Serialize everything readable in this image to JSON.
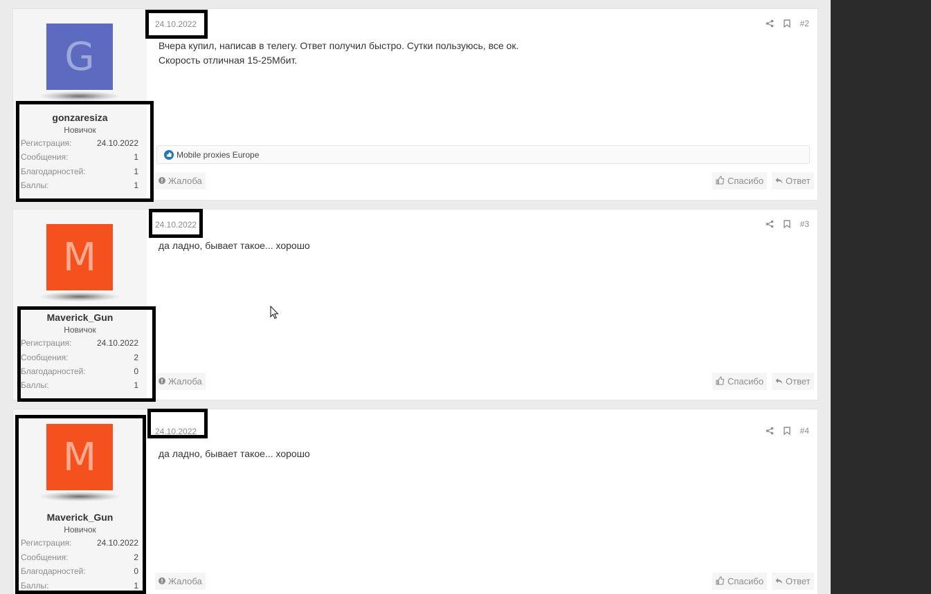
{
  "posts": [
    {
      "date": "24.10.2022",
      "number": "#2",
      "avatar_letter": "G",
      "avatar_bg": "#5c6bc0",
      "avatar_fg": "#9fa8da",
      "username": "gonzaresiza",
      "user_title": "Новичок",
      "stats": [
        {
          "label": "Регистрация:",
          "value": "24.10.2022"
        },
        {
          "label": "Сообщения:",
          "value": "1"
        },
        {
          "label": "Благодарностей:",
          "value": "1"
        },
        {
          "label": "Баллы:",
          "value": "1"
        }
      ],
      "body_lines": [
        "Вчера купил, написав в телегу. Ответ получил быстро. Сутки пользуюсь, все ок.",
        "Скорость отличная 15-25Мбит."
      ],
      "reaction_users": "Mobile proxies Europe",
      "report_label": "Жалоба",
      "like_label": "Спасибо",
      "reply_label": "Ответ"
    },
    {
      "date": "24.10.2022",
      "number": "#3",
      "avatar_letter": "M",
      "avatar_bg": "#f4511e",
      "avatar_fg": "#ffab91",
      "username": "Maverick_Gun",
      "user_title": "Новичок",
      "stats": [
        {
          "label": "Регистрация:",
          "value": "24.10.2022"
        },
        {
          "label": "Сообщения:",
          "value": "2"
        },
        {
          "label": "Благодарностей:",
          "value": "0"
        },
        {
          "label": "Баллы:",
          "value": "1"
        }
      ],
      "body_lines": [
        "да ладно, бывает такое... хорошо"
      ],
      "report_label": "Жалоба",
      "like_label": "Спасибо",
      "reply_label": "Ответ"
    },
    {
      "date": "24.10.2022",
      "number": "#4",
      "avatar_letter": "M",
      "avatar_bg": "#f4511e",
      "avatar_fg": "#ffab91",
      "username": "Maverick_Gun",
      "user_title": "Новичок",
      "stats": [
        {
          "label": "Регистрация:",
          "value": "24.10.2022"
        },
        {
          "label": "Сообщения:",
          "value": "2"
        },
        {
          "label": "Благодарностей:",
          "value": "0"
        },
        {
          "label": "Баллы:",
          "value": "1"
        }
      ],
      "body_lines": [
        "да ладно, бывает такое... хорошо"
      ],
      "report_label": "Жалоба",
      "like_label": "Спасибо",
      "reply_label": "Ответ"
    }
  ]
}
